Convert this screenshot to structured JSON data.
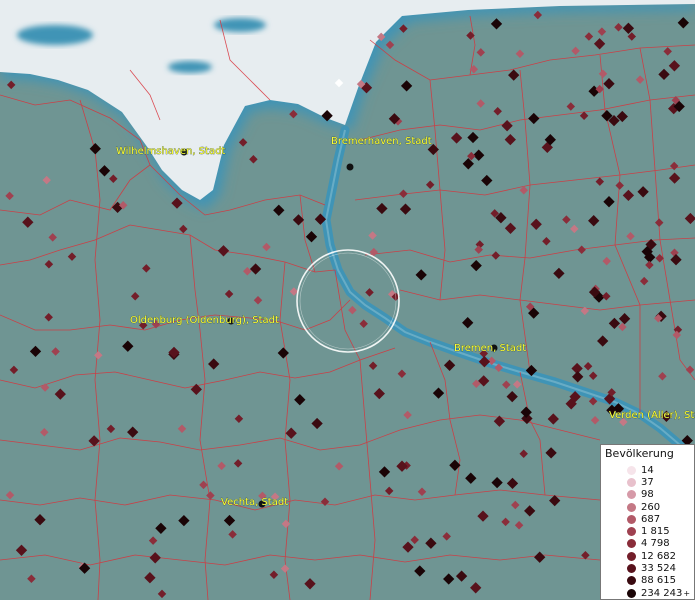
{
  "map": {
    "colors": {
      "land": "#6f9593",
      "sea": "#e7edf0",
      "water": "#3f94b6",
      "borders": "#d9323a",
      "label": "#ffff33"
    },
    "cities": [
      {
        "name": "Wilhelmshaven, Stadt"
      },
      {
        "name": "Bremerhaven, Stadt"
      },
      {
        "name": "Oldenburg (Oldenburg), Stadt"
      },
      {
        "name": "Bremen, Stadt"
      },
      {
        "name": "Verden (Aller), Stadt"
      },
      {
        "name": "Vechta, Stadt"
      }
    ]
  },
  "legend": {
    "title": "Bevölkerung",
    "items": [
      {
        "label": "14",
        "color": "#f6e4ea"
      },
      {
        "label": "37",
        "color": "#e8c1cc"
      },
      {
        "label": "98",
        "color": "#d69aa8"
      },
      {
        "label": "260",
        "color": "#c47885"
      },
      {
        "label": "687",
        "color": "#b25a68"
      },
      {
        "label": "1 815",
        "color": "#9f4150"
      },
      {
        "label": "4 798",
        "color": "#8a2d3a"
      },
      {
        "label": "12 682",
        "color": "#731e2a"
      },
      {
        "label": "33 524",
        "color": "#58121c"
      },
      {
        "label": "88 615",
        "color": "#3a0a10"
      },
      {
        "label": "234 243",
        "color": "#1a0406",
        "plus": "+"
      }
    ]
  }
}
